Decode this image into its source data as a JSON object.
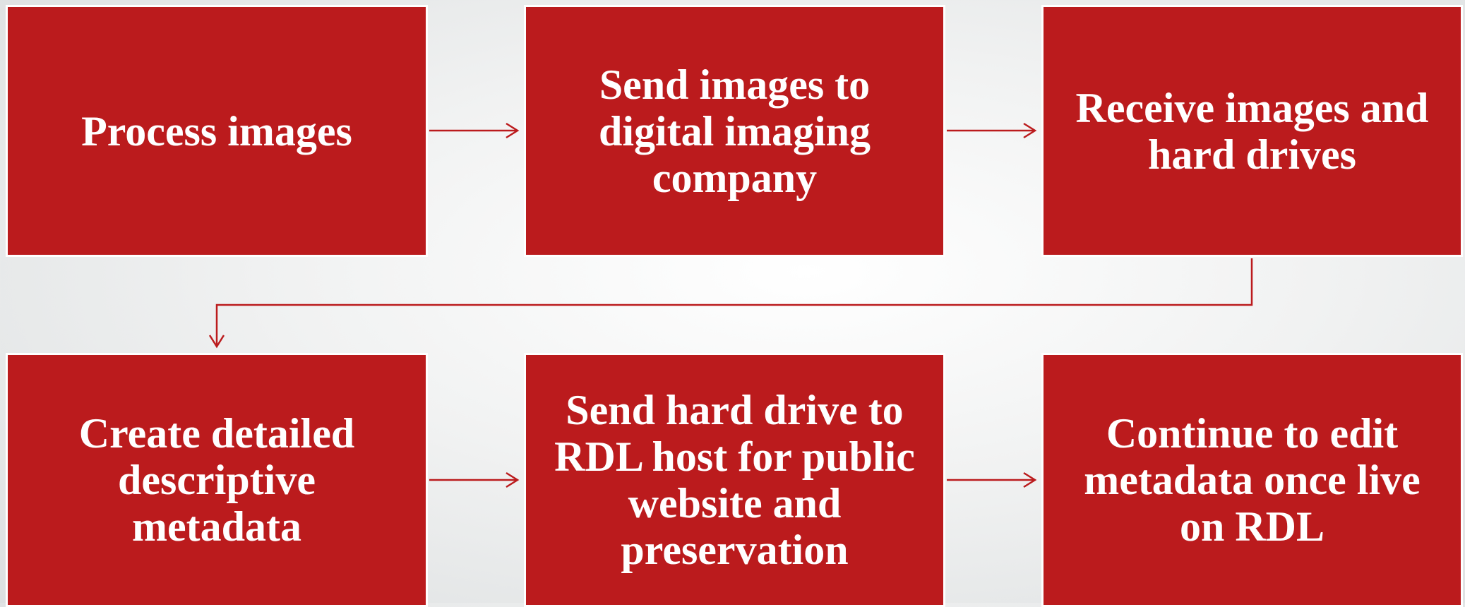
{
  "diagram": {
    "colors": {
      "box_fill": "#bb1b1d",
      "box_border": "#ffffff",
      "text": "#ffffff",
      "connector": "#bb1b1d"
    },
    "steps": [
      {
        "label": "Process images"
      },
      {
        "label": "Send images to digital imaging company"
      },
      {
        "label": "Receive images and hard drives"
      },
      {
        "label": "Create detailed descriptive metadata"
      },
      {
        "label": "Send hard drive to RDL host for public website and preservation"
      },
      {
        "label": "Continue to edit metadata once live on RDL"
      }
    ]
  }
}
